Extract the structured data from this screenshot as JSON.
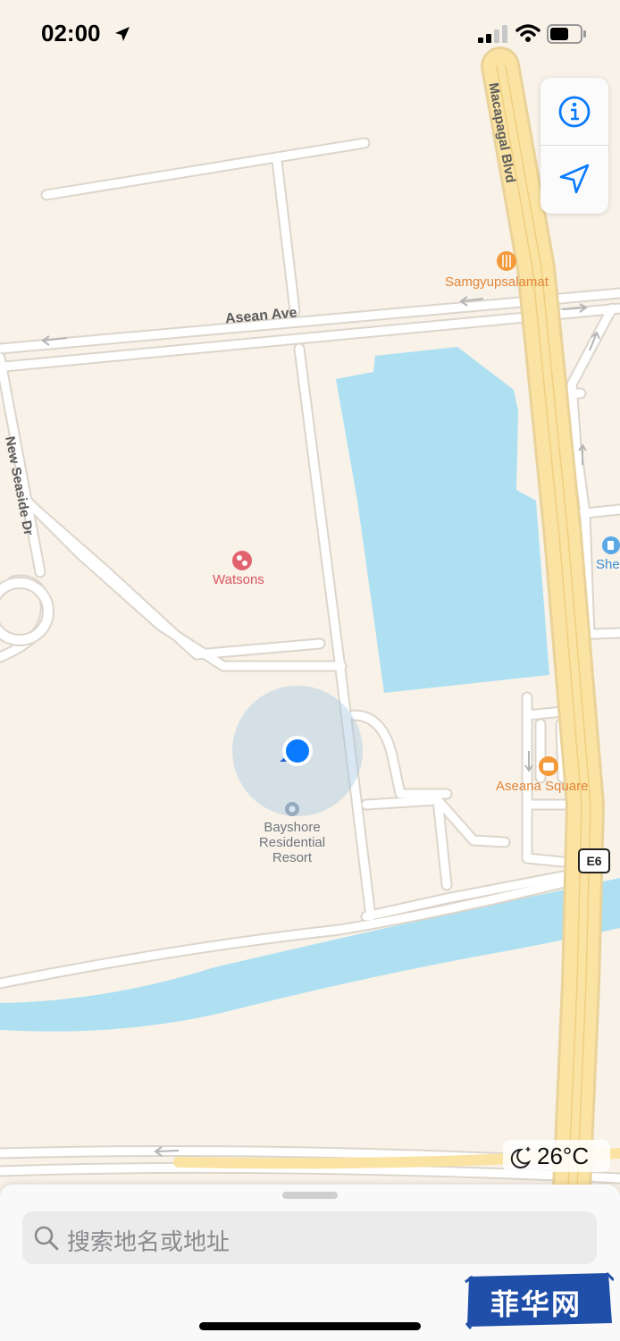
{
  "status_bar": {
    "time": "02:00",
    "icons": [
      "location-arrow-icon",
      "cellular-signal-icon",
      "wifi-icon",
      "battery-icon"
    ]
  },
  "map_controls": {
    "info_icon": "info-icon",
    "locate_icon": "location-arrow-icon"
  },
  "map": {
    "roads": {
      "macapagal": "Macapagal Blvd",
      "asean": "Asean Ave",
      "new_seaside": "New Seaside Dr",
      "highway_shield": "E6"
    },
    "pois": {
      "samgyup": "Samgyupsalamat",
      "watsons": "Watsons",
      "shell": "She",
      "aseana": "Aseana Square",
      "bayshore_line1": "Bayshore",
      "bayshore_line2": "Residential",
      "bayshore_line3": "Resort"
    },
    "colors": {
      "land": "#f8f2e9",
      "water": "#aee0f2",
      "highway": "#fbe3a3",
      "road": "#ffffff",
      "user_location": "#0a7aff",
      "poi_orange": "#f39a3a",
      "poi_pink": "#e0636f"
    }
  },
  "weather": {
    "icon": "moon-stars-icon",
    "temperature": "26°C"
  },
  "search": {
    "placeholder": "搜索地名或地址"
  },
  "watermark": {
    "text": "菲华网"
  }
}
